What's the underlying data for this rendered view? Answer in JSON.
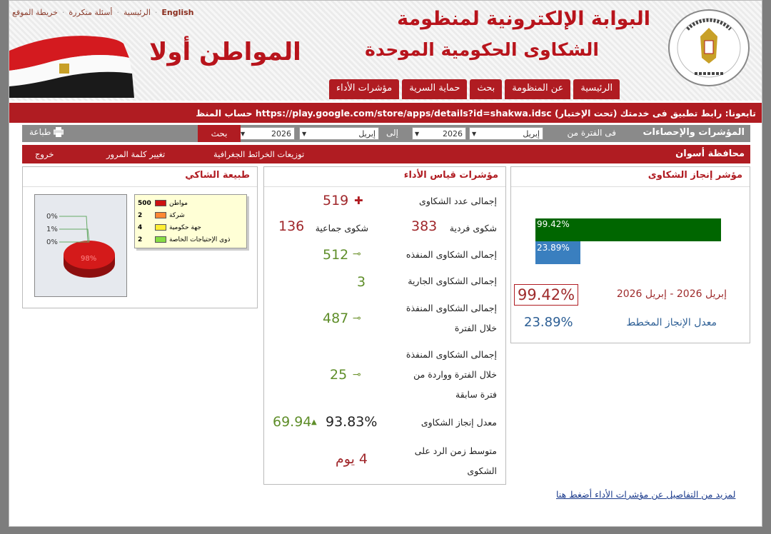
{
  "toplinks": {
    "english": "English",
    "home": "الرئيسية",
    "faq": "أسئلة متكررة",
    "sitemap": "خريطة الموقع"
  },
  "header": {
    "title_line1": "البوابة الإلكترونية لمنظومة",
    "title_line2": "الشكاوى الحكومية الموحدة",
    "slogan": "المواطن أولا",
    "logo_text": "منظومة الشكاوى الحكومية الموحدة",
    "logo_sub": "مجلس الوزراء"
  },
  "tabs": [
    {
      "label": "الرئيسية"
    },
    {
      "label": "عن المنظومة"
    },
    {
      "label": "بحث"
    },
    {
      "label": "حماية السرية"
    },
    {
      "label": "مؤشرات الأداء"
    }
  ],
  "ticker": "تابعونا: رابط تطبيق فى خدمتك (تحت الإختبار) https://play.google.com/store/apps/details?id=shakwa.idsc حساب المنظ",
  "filter": {
    "title": "المؤشرات والإحصاءات",
    "period_from": "فى الفترة من",
    "to": "إلى",
    "from_month": "إبريل",
    "from_year": "2026",
    "to_month": "إبريل",
    "to_year": "2026",
    "search": "بحث",
    "print": "طباعة"
  },
  "subbar": {
    "governorate": "محافظة أسوان",
    "geo": "توزيعات الخرائط الجغرافية",
    "change_pw": "تغيير كلمة المرور",
    "logout": "خروج"
  },
  "achievement": {
    "title": "مؤشر إنجاز الشكاوى",
    "bar1_label": "99.42%",
    "bar1_value": 99.42,
    "bar2_label": "23.89%",
    "bar2_value": 23.89,
    "period_text": "إبريل 2026 - إبريل 2026",
    "period_value": "99.42%",
    "planned_label": "معدل الإنجاز المخطط",
    "planned_value": "23.89%",
    "colors": {
      "bar1": "#006600",
      "bar2": "#3a7fbf"
    }
  },
  "kpi": {
    "title": "مؤشرات قياس الأداء",
    "total_label": "إجمالى عدد الشكاوى",
    "total_value": "519",
    "individual_label": "شكوى فردية",
    "individual_value": "383",
    "group_label": "شكوى جماعية",
    "group_value": "136",
    "executed_label": "إجمالى الشكاوى المنفذه",
    "executed_value": "512",
    "current_label": "إجمالى الشكاوى الجارية",
    "current_value": "3",
    "executed_period_l1": "إجمالى الشكاوى المنفذة",
    "executed_period_l2": "خلال الفترة",
    "executed_period_value": "487",
    "prev_l1": "إجمالى الشكاوى المنفذة",
    "prev_l2": "خلال الفترة وواردة من",
    "prev_l3": "فترة سابقة",
    "prev_value": "25",
    "rate_label": "معدل إنجاز الشكاوى",
    "rate_value": "93.83%",
    "rate_change": "69.94",
    "response_l1": "متوسط زمن الرد على",
    "response_l2": "الشكوى",
    "response_value": "4 يوم"
  },
  "complainant": {
    "title": "طبيعة الشاكي",
    "legend": [
      {
        "label": "مواطن",
        "value": "500",
        "color": "#cc1111"
      },
      {
        "label": "شركة",
        "value": "2",
        "color": "#ff8833"
      },
      {
        "label": "جهة حكومية",
        "value": "4",
        "color": "#ffee33"
      },
      {
        "label": "ذوى الإحتياجات الخاصة",
        "value": "2",
        "color": "#88dd44"
      }
    ],
    "pie_labels": [
      "0%",
      "1%",
      "0%"
    ],
    "pie_main": "98%"
  },
  "more_link": "لمزيد من التفاصيل عن مؤشرات الأداء أضغط هنا"
}
